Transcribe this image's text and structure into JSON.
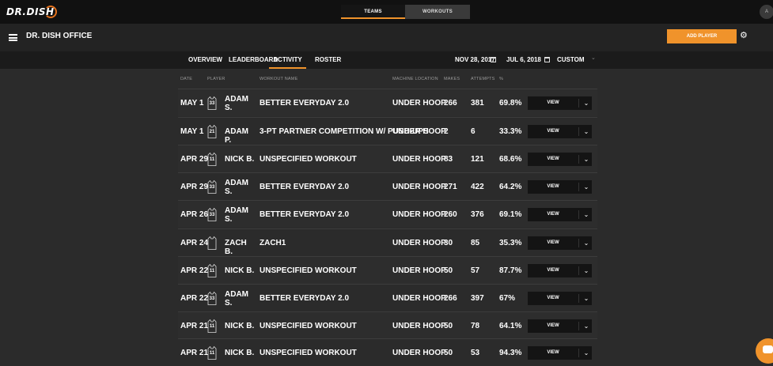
{
  "app": {
    "logo_text": "Dr.Dish",
    "top_tabs": [
      "Teams",
      "Workouts"
    ],
    "user_initial": "A"
  },
  "header": {
    "title": "DR. DISH OFFICE",
    "add_player_label": "ADD PLAYER"
  },
  "nav": {
    "tabs": [
      {
        "label": "OVERVIEW",
        "active": false
      },
      {
        "label": "LEADERBOARD",
        "active": false
      },
      {
        "label": "ACTIVITY",
        "active": true
      },
      {
        "label": "ROSTER",
        "active": false
      }
    ],
    "date_start": "NOV 28, 2017",
    "date_end": "JUL 6, 2018",
    "range": "CUSTOM"
  },
  "table": {
    "columns": [
      "DATE",
      "PLAYER",
      "WORKOUT NAME",
      "MACHINE LOCATION",
      "MAKES",
      "ATTEMPTS",
      "%"
    ],
    "view_label": "VIEW",
    "rows": [
      {
        "date": "MAY 1",
        "jersey": "33",
        "player": "ADAM S.",
        "workout": "BETTER EVERYDAY 2.0",
        "location": "UNDER HOOP",
        "makes": "266",
        "attempts": "381",
        "pct": "69.8%"
      },
      {
        "date": "MAY 1",
        "jersey": "21",
        "player": "ADAM P.",
        "workout": "3-PT PARTNER COMPETITION W/ PUSH-UPS",
        "location": "UNDER HOOP",
        "makes": "2",
        "attempts": "6",
        "pct": "33.3%"
      },
      {
        "date": "APR 29",
        "jersey": "11",
        "player": "NICK B.",
        "workout": "UNSPECIFIED WORKOUT",
        "location": "UNDER HOOP",
        "makes": "83",
        "attempts": "121",
        "pct": "68.6%"
      },
      {
        "date": "APR 29",
        "jersey": "33",
        "player": "ADAM S.",
        "workout": "BETTER EVERYDAY 2.0",
        "location": "UNDER HOOP",
        "makes": "271",
        "attempts": "422",
        "pct": "64.2%"
      },
      {
        "date": "APR 26",
        "jersey": "33",
        "player": "ADAM S.",
        "workout": "BETTER EVERYDAY 2.0",
        "location": "UNDER HOOP",
        "makes": "260",
        "attempts": "376",
        "pct": "69.1%"
      },
      {
        "date": "APR 24",
        "jersey": "",
        "player": "ZACH B.",
        "workout": "ZACH1",
        "location": "UNDER HOOP",
        "makes": "30",
        "attempts": "85",
        "pct": "35.3%"
      },
      {
        "date": "APR 22",
        "jersey": "11",
        "player": "NICK B.",
        "workout": "UNSPECIFIED WORKOUT",
        "location": "UNDER HOOP",
        "makes": "50",
        "attempts": "57",
        "pct": "87.7%"
      },
      {
        "date": "APR 22",
        "jersey": "33",
        "player": "ADAM S.",
        "workout": "BETTER EVERYDAY 2.0",
        "location": "UNDER HOOP",
        "makes": "266",
        "attempts": "397",
        "pct": "67%"
      },
      {
        "date": "APR 21",
        "jersey": "11",
        "player": "NICK B.",
        "workout": "UNSPECIFIED WORKOUT",
        "location": "UNDER HOOP",
        "makes": "50",
        "attempts": "78",
        "pct": "64.1%"
      },
      {
        "date": "APR 21",
        "jersey": "11",
        "player": "NICK B.",
        "workout": "UNSPECIFIED WORKOUT",
        "location": "UNDER HOOP",
        "makes": "50",
        "attempts": "53",
        "pct": "94.3%"
      }
    ]
  },
  "colors": {
    "accent": "#f0932b",
    "background": "#2b2b2b",
    "header": "#111111"
  }
}
